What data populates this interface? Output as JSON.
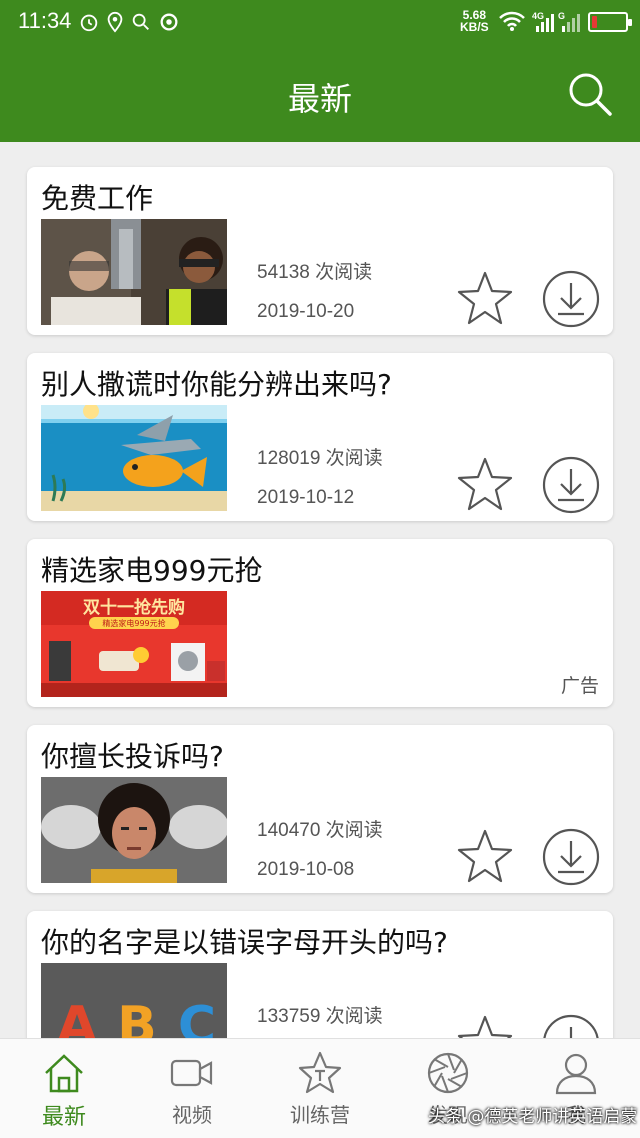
{
  "status_bar": {
    "time": "11:34",
    "net_speed_value": "5.68",
    "net_speed_unit": "KB/S",
    "signal_1": "4G",
    "signal_2": "G",
    "battery_level_fraction": 0.15,
    "battery_color": "#e53935"
  },
  "header": {
    "title": "最新",
    "search_icon": "search-icon"
  },
  "theme": {
    "primary": "#3e8a1e",
    "background": "#eeeeee"
  },
  "feed": [
    {
      "title": "免费工作",
      "reads": "54138 次阅读",
      "date": "2019-10-20",
      "type": "article"
    },
    {
      "title": "别人撒谎时你能分辨出来吗?",
      "reads": "128019 次阅读",
      "date": "2019-10-12",
      "type": "article"
    },
    {
      "title": "精选家电999元抢",
      "ad_label": "广告",
      "type": "ad",
      "banner_text": "双十一抢先购",
      "banner_sub": "精选家电999元抢"
    },
    {
      "title": "你擅长投诉吗?",
      "reads": "140470 次阅读",
      "date": "2019-10-08",
      "type": "article"
    },
    {
      "title": "你的名字是以错误字母开头的吗?",
      "reads": "133759 次阅读",
      "type": "article",
      "thumb_letters": [
        "A",
        "B",
        "C"
      ]
    }
  ],
  "bottom_nav": [
    {
      "label": "最新",
      "icon": "home-icon",
      "active": true
    },
    {
      "label": "视频",
      "icon": "video-icon",
      "active": false
    },
    {
      "label": "训练营",
      "icon": "training-star-icon",
      "active": false
    },
    {
      "label": "发现",
      "icon": "aperture-icon",
      "active": false
    },
    {
      "label": "我",
      "icon": "user-icon",
      "active": false
    }
  ],
  "watermark": "头条 @德英老师讲英语启蒙"
}
